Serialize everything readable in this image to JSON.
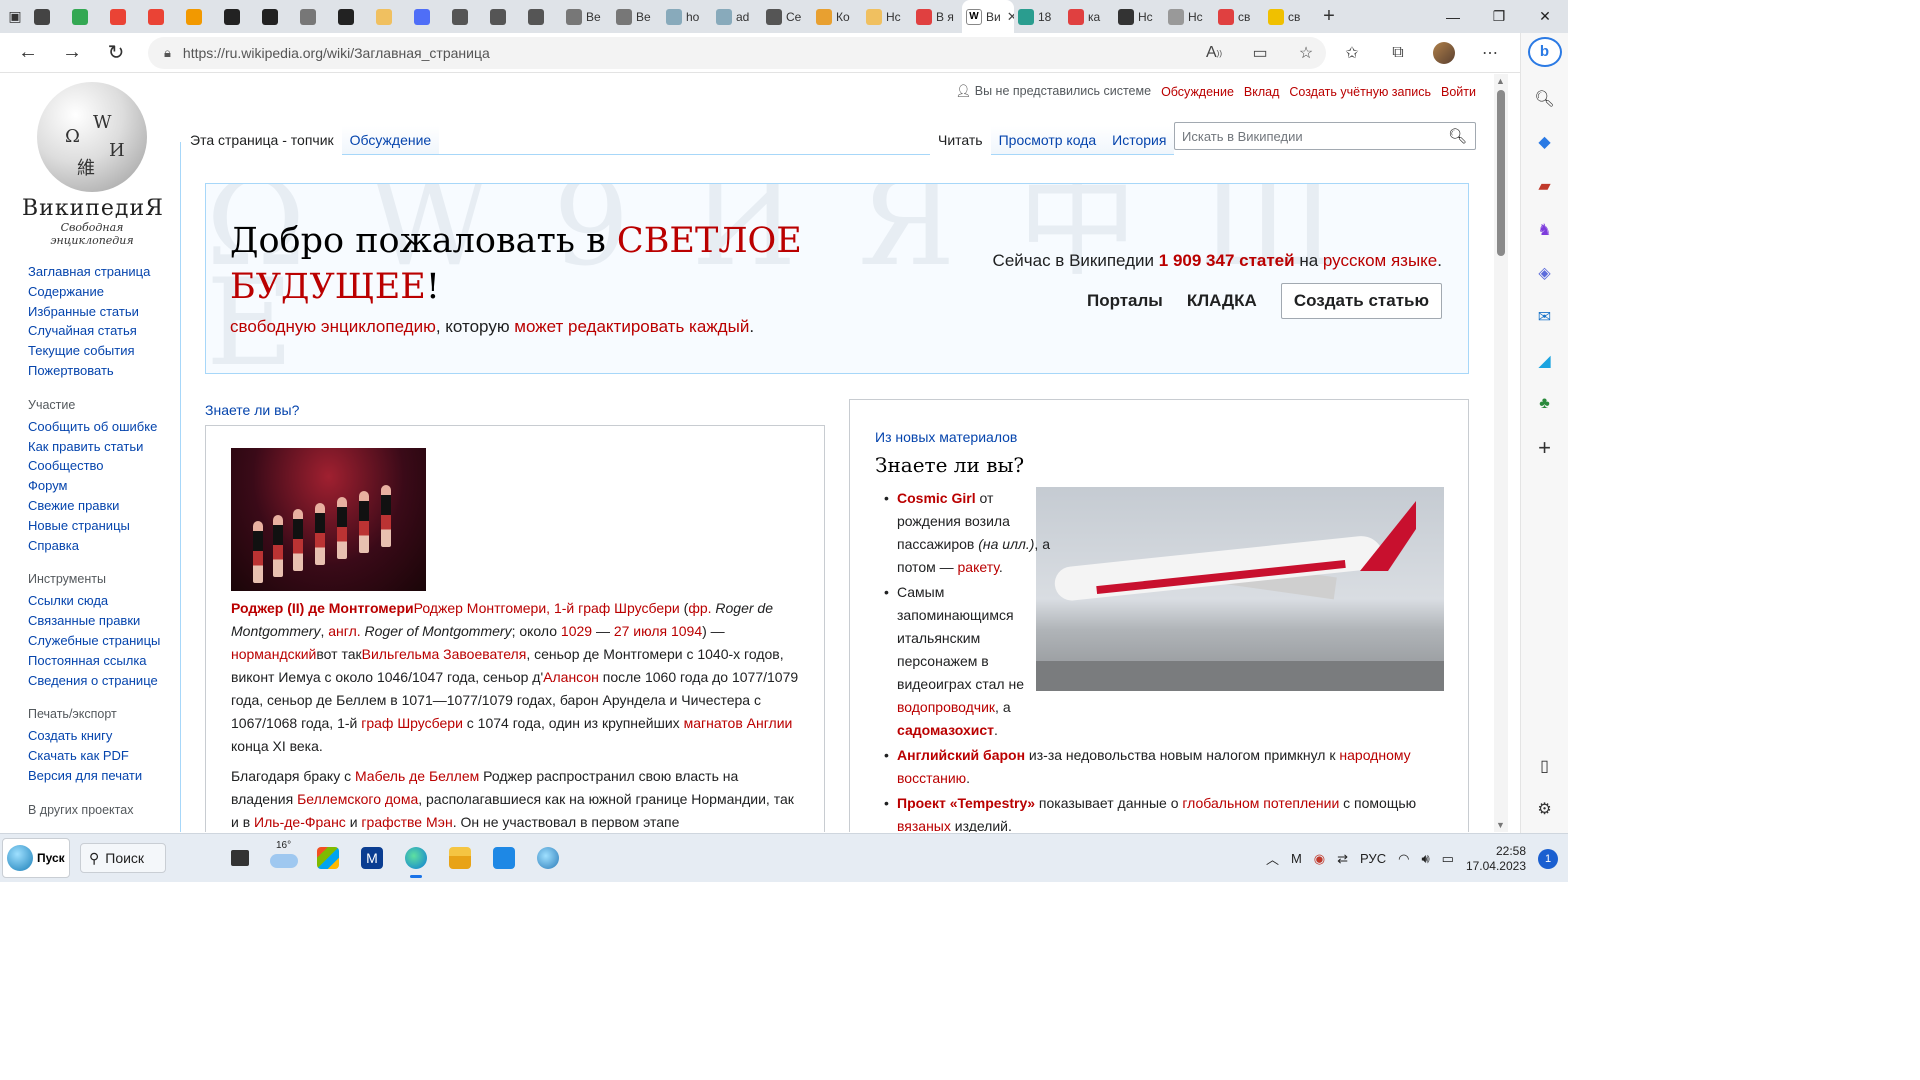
{
  "browser": {
    "tabs": [
      {
        "label": "",
        "color": "#444"
      },
      {
        "label": "",
        "color": "#34a853"
      },
      {
        "label": "",
        "color": "#ea4335"
      },
      {
        "label": "",
        "color": "#ea4335"
      },
      {
        "label": "",
        "color": "#f29900"
      },
      {
        "label": "",
        "color": "#222"
      },
      {
        "label": "",
        "color": "#222"
      },
      {
        "label": "",
        "color": "#777"
      },
      {
        "label": "",
        "color": "#222"
      },
      {
        "label": "",
        "color": "#f0c060"
      },
      {
        "label": "",
        "color": "#4f6ef7"
      },
      {
        "label": "",
        "color": "#555"
      },
      {
        "label": "",
        "color": "#555"
      },
      {
        "label": "",
        "color": "#555"
      },
      {
        "label": "Be",
        "color": "#777"
      },
      {
        "label": "Be",
        "color": "#777"
      },
      {
        "label": "ho",
        "color": "#8ab"
      },
      {
        "label": "ad",
        "color": "#8ab"
      },
      {
        "label": "Се",
        "color": "#555"
      },
      {
        "label": "Ко",
        "color": "#e8a030"
      },
      {
        "label": "Нс",
        "color": "#f0c060"
      },
      {
        "label": "В я",
        "color": "#e04040"
      },
      {
        "label": "Ви",
        "color": "#fff",
        "active": true
      },
      {
        "label": "18",
        "color": "#2a9d8f"
      },
      {
        "label": "ка",
        "color": "#e04040"
      },
      {
        "label": "Нс",
        "color": "#333"
      },
      {
        "label": "Нс",
        "color": "#999"
      },
      {
        "label": "св",
        "color": "#e04040"
      },
      {
        "label": "св",
        "color": "#f0c000"
      }
    ],
    "url": "https://ru.wikipedia.org/wiki/Заглавная_страница"
  },
  "wiki": {
    "logo_name": "ВикипедиЯ",
    "logo_slogan": "Свободная энциклопедия",
    "user_tools": {
      "anon": "Вы не представились системе",
      "talk": "Обсуждение",
      "contrib": "Вклад",
      "create_account": "Создать учётную запись",
      "login": "Войти"
    },
    "tabs_left": [
      "Эта страница - топчик",
      "Обсуждение"
    ],
    "tabs_right": [
      "Читать",
      "Просмотр кода",
      "История"
    ],
    "search_placeholder": "Искать в Википедии",
    "sidebar": {
      "main": [
        "Заглавная страница",
        "Содержание",
        "Избранные статьи",
        "Случайная статья",
        "Текущие события",
        "Пожертвовать"
      ],
      "participation_title": "Участие",
      "participation": [
        "Сообщить об ошибке",
        "Как править статьи",
        "Сообщество",
        "Форум",
        "Свежие правки",
        "Новые страницы",
        "Справка"
      ],
      "tools_title": "Инструменты",
      "tools": [
        "Ссылки сюда",
        "Связанные правки",
        "Служебные страницы",
        "Постоянная ссылка",
        "Сведения о странице"
      ],
      "print_title": "Печать/экспорт",
      "print": [
        "Создать книгу",
        "Скачать как PDF",
        "Версия для печати"
      ],
      "other_title": "В других проектах"
    },
    "welcome": {
      "title_prefix": "Добро пожаловать в ",
      "title_highlight": "СВЕТЛОЕ БУДУЩЕЕ",
      "title_suffix": "!",
      "sub_link1": "свободную энциклопедию",
      "sub_mid": ", которую ",
      "sub_link2": "может редактировать каждый",
      "sub_end": ".",
      "stats_prefix": "Сейчас в Википедии ",
      "stats_count": "1 909 347 статей",
      "stats_mid": " на ",
      "stats_lang": "русском языке",
      "stats_end": ".",
      "portals": "Порталы",
      "kladka": "КЛАДКА",
      "create_article": "Создать статью",
      "bg_text": "Ω W 9 И Я 中 Ш Е"
    },
    "left_col": {
      "title": "Знаете ли вы?",
      "p1": {
        "name_bold": "Роджер (II) де Монтгомери",
        "name_link": "Роджер Монтгомери, 1-й граф Шрусбери",
        "t1": " (",
        "fr": "фр.",
        "t2": " ",
        "fr_name": "Roger de Montgommery",
        "t3": ", ",
        "en": "англ.",
        "t4": " ",
        "en_name": "Roger of Montgommery",
        "t5": "; около ",
        "d1": "1029",
        "t6": " — ",
        "d2": "27 июля 1094",
        "t7": ") — ",
        "norm": "нормандский",
        "t8": "вот так",
        "will": "Вильгельма Завоевателя",
        "t9": ", сеньор де Монтгомери с 1040-х годов, виконт Иемуа с около 1046/1047 года, сеньор д'",
        "alan": "Алансон",
        "t10": " после 1060 года до 1077/1079 года, сеньор де Беллем в 1071—1077/1079 годах, барон Арундела и Чичестера с 1067/1068 года, 1-й ",
        "graf": "граф Шрусбери",
        "t11": " с 1074 года, один из крупнейших ",
        "mag": "магнатов Англии",
        "t12": " конца XI века."
      },
      "p2": {
        "t1": "Благодаря браку с ",
        "mabel": "Мабель де Беллем",
        "t2": " Роджер распространил свою власть на владения ",
        "house": "Беллемского дома",
        "t3": ", располагавшиеся как на южной границе Нормандии, так и в ",
        "idf": "Иль-де-Франс",
        "t4": " и ",
        "maine": "графстве Мэн",
        "t5": ". Он не участвовал в первом этапе"
      }
    },
    "right_col": {
      "kicker": "Из новых материалов",
      "title": "Знаете ли вы?",
      "i1": {
        "bold": "Cosmic Girl",
        "t1": " от рождения возила пассажиров ",
        "ill": "(на илл.)",
        "t2": ", а потом — ",
        "link": "ракету",
        "t3": "."
      },
      "i2": {
        "t1": "Самым запоминающимся итальянским персонажем в видеоиграх стал не ",
        "link1": "водопроводчик",
        "t2": ", а ",
        "link2": "садомазохист",
        "t3": "."
      },
      "i3": {
        "bold": "Английский барон",
        "t1": " из-за недовольства новым налогом примкнул к ",
        "link": "народному восстанию",
        "t2": "."
      },
      "i4": {
        "bold": "Проект «Tempestry»",
        "t1": " показывает данные о ",
        "link1": "глобальном потеплении",
        "t2": " с помощью ",
        "link2": "вязаных",
        "t3": " изделий."
      }
    }
  },
  "taskbar": {
    "start_label": "Пуск",
    "search_label": "Поиск",
    "weather_temp": "16°",
    "lang": "РУС",
    "time": "22:58",
    "date": "17.04.2023",
    "notif": "1"
  }
}
